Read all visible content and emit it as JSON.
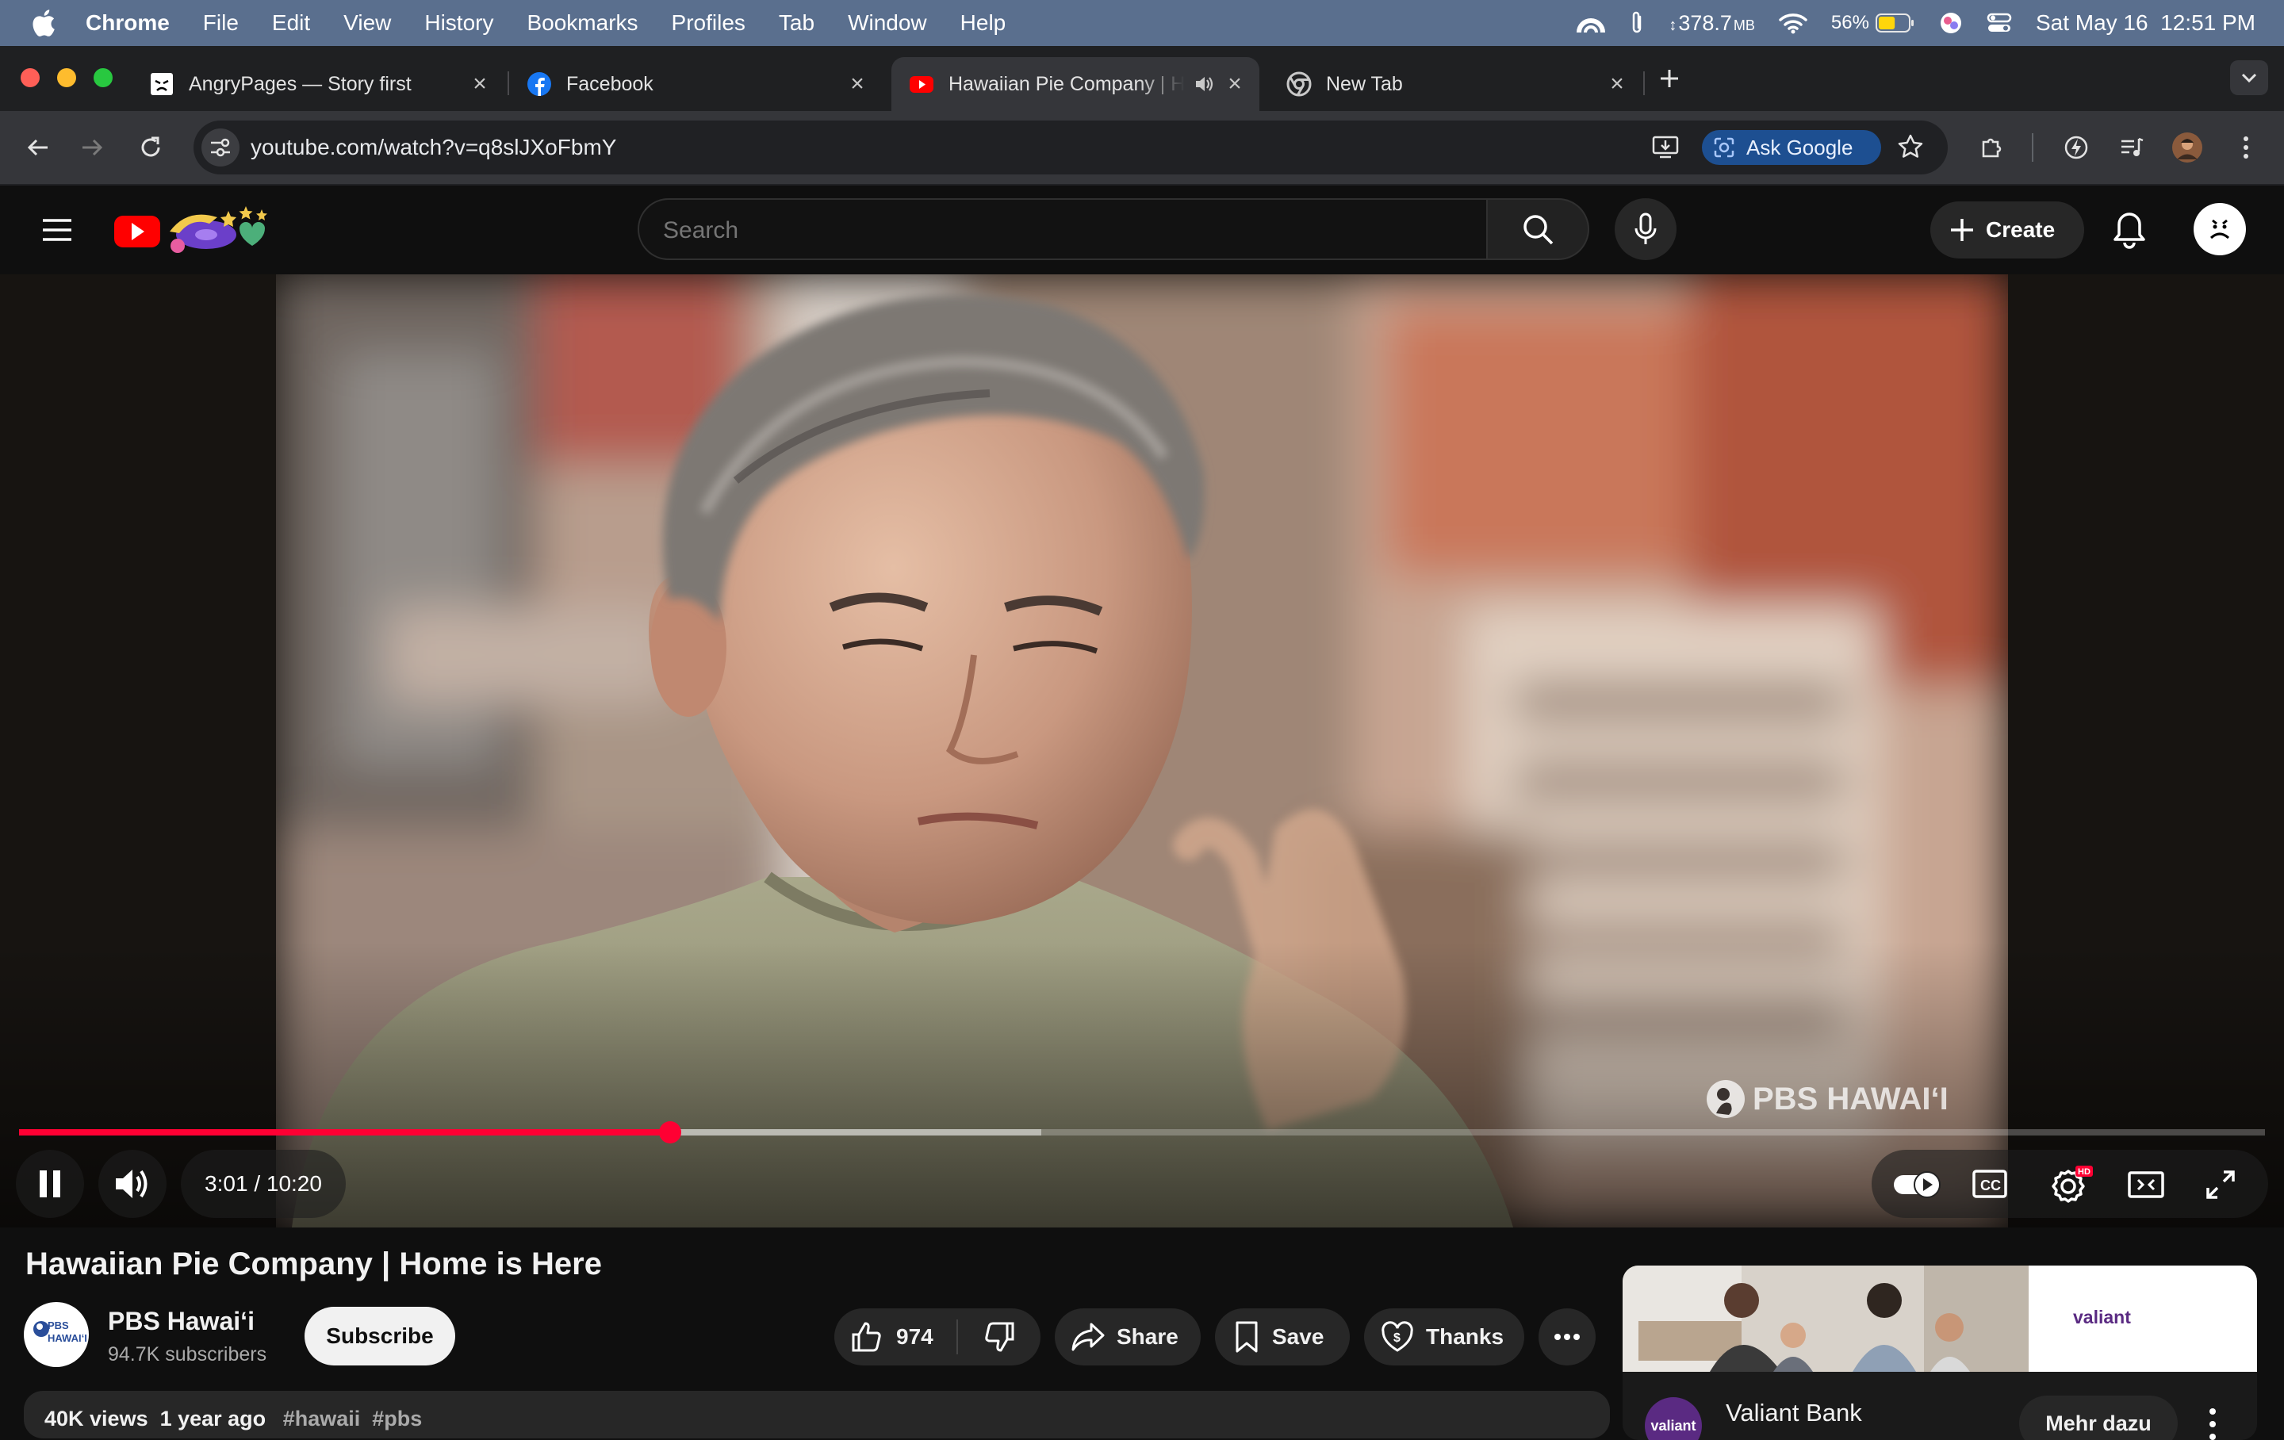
{
  "menubar": {
    "app": "Chrome",
    "items": [
      "File",
      "Edit",
      "View",
      "History",
      "Bookmarks",
      "Profiles",
      "Tab",
      "Window",
      "Help"
    ],
    "memory": "378.7",
    "memory_unit": "MB",
    "battery": "56%",
    "battery_level": 0.56,
    "datetime": "Sat May 16  12:51 PM"
  },
  "tabs": [
    {
      "title": "AngryPages — Story first",
      "icon": "angrypages-icon"
    },
    {
      "title": "Facebook",
      "icon": "facebook-icon"
    },
    {
      "title": "Hawaiian Pie Company | Home is Here - YouTube",
      "icon": "youtube-icon",
      "active": true,
      "audio": true
    },
    {
      "title": "New Tab",
      "icon": "chrome-icon"
    }
  ],
  "toolbar": {
    "url": "youtube.com/watch?v=q8slJXoFbmY",
    "ask_google": "Ask Google"
  },
  "youtube": {
    "search_placeholder": "Search",
    "create_label": "Create"
  },
  "player": {
    "current_time": "3:01",
    "duration": "10:20",
    "time_display": "3:01 / 10:20",
    "played_fraction": 0.29,
    "buffered_fraction": 0.455,
    "watermark": "PBS HAWAIʻI",
    "hd_badge": "HD"
  },
  "video": {
    "title": "Hawaiian Pie Company | Home is Here",
    "channel": "PBS Hawaiʻi",
    "channel_avatar_text": "PBS HAWAIʻI",
    "subscribers": "94.7K subscribers",
    "subscribe_label": "Subscribe",
    "likes": "974",
    "share_label": "Share",
    "save_label": "Save",
    "thanks_label": "Thanks",
    "views_date": "40K views  1 year ago",
    "tags": "#hawaii  #pbs"
  },
  "ad": {
    "logo_text": "valiant",
    "avatar_text": "valiant",
    "advertiser": "Valiant Bank",
    "cta": "Mehr dazu"
  },
  "colors": {
    "accent_red": "#ff0033",
    "youtube_red": "#ff0000",
    "menubar_bg": "#5a6f8e",
    "chrome_dark": "#35363a"
  }
}
